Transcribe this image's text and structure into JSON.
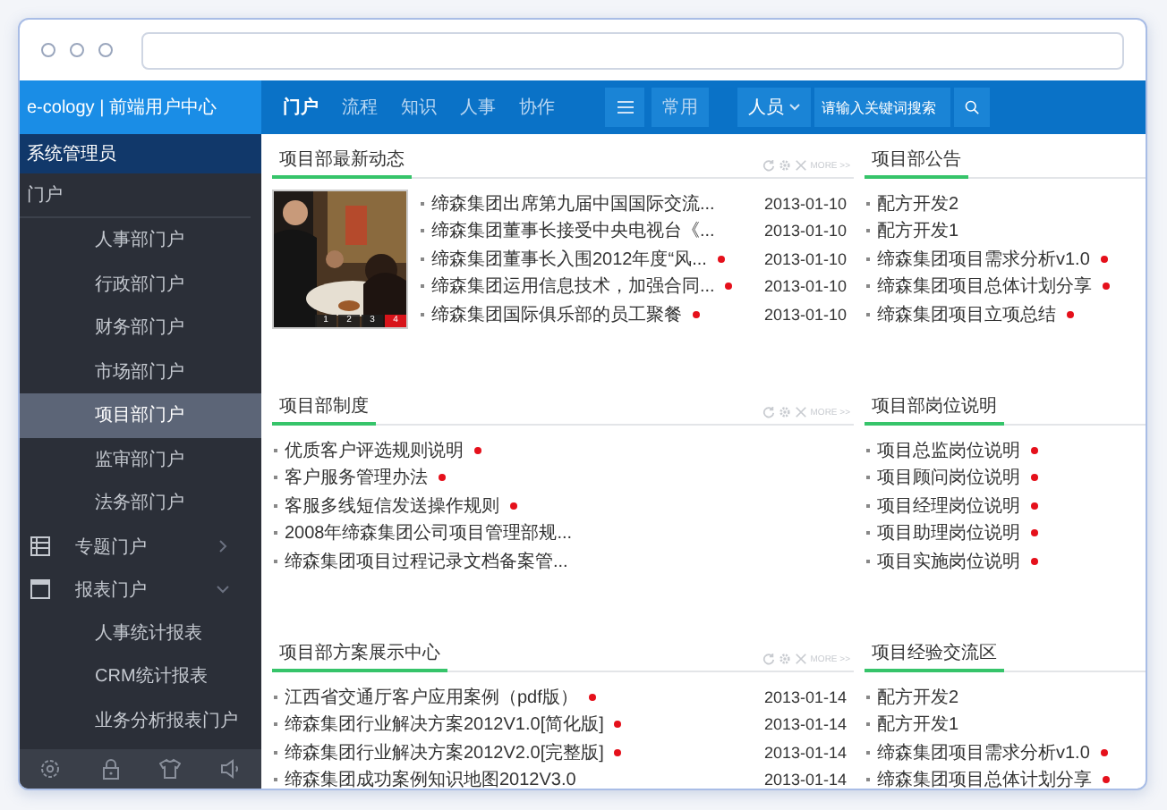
{
  "header": {
    "logo": "e-cology | 前端用户中心",
    "nav": [
      {
        "label": "门户",
        "selected": true
      },
      {
        "label": "流程",
        "selected": false
      },
      {
        "label": "知识",
        "selected": false
      },
      {
        "label": "人事",
        "selected": false
      },
      {
        "label": "协作",
        "selected": false
      }
    ],
    "common_button": "常用",
    "scope": "人员",
    "search": {
      "placeholder": "请输入关键词搜索"
    }
  },
  "sidebar": {
    "user": "系统管理员",
    "items": [
      {
        "label": "门户",
        "kind": "group",
        "children": [
          {
            "label": "人事部门户",
            "selected": false
          },
          {
            "label": "行政部门户",
            "selected": false
          },
          {
            "label": "财务部门户",
            "selected": false
          },
          {
            "label": "市场部门户",
            "selected": false
          },
          {
            "label": "项目部门户",
            "selected": true
          },
          {
            "label": "监审部门户",
            "selected": false
          },
          {
            "label": "法务部门户",
            "selected": false
          }
        ]
      },
      {
        "label": "专题门户",
        "kind": "table",
        "expanded": false
      },
      {
        "label": "报表门户",
        "kind": "window",
        "expanded": true,
        "children": [
          {
            "label": "人事统计报表",
            "selected": false
          },
          {
            "label": "CRM统计报表",
            "selected": false
          },
          {
            "label": "业务分析报表门户",
            "selected": false
          }
        ]
      }
    ]
  },
  "sections": [
    {
      "left": {
        "title": "项目部最新动态",
        "more": "MORE >>",
        "slideshow": {
          "pages": [
            {
              "label": "1",
              "selected": false
            },
            {
              "label": "2",
              "selected": false
            },
            {
              "label": "3",
              "selected": false
            },
            {
              "label": "4",
              "selected": true
            }
          ]
        },
        "items": [
          {
            "title": "缔森集团出席第九届中国国际交流...",
            "date": "2013-01-10",
            "new": false
          },
          {
            "title": "缔森集团董事长接受中央电视台《...",
            "date": "2013-01-10",
            "new": false
          },
          {
            "title": "缔森集团董事长入围2012年度“风...",
            "date": "2013-01-10",
            "new": true
          },
          {
            "title": "缔森集团运用信息技术，加强合同...",
            "date": "2013-01-10",
            "new": true
          },
          {
            "title": "缔森集团国际俱乐部的员工聚餐",
            "date": "2013-01-10",
            "new": true
          }
        ]
      },
      "right": {
        "title": "项目部公告",
        "items": [
          {
            "title": "配方开发2",
            "new": false
          },
          {
            "title": "配方开发1",
            "new": false
          },
          {
            "title": "缔森集团项目需求分析v1.0",
            "new": true
          },
          {
            "title": "缔森集团项目总体计划分享",
            "new": true
          },
          {
            "title": "缔森集团项目立项总结",
            "new": true
          }
        ]
      }
    },
    {
      "left": {
        "title": "项目部制度",
        "more": "MORE >>",
        "items": [
          {
            "title": "优质客户评选规则说明",
            "new": true
          },
          {
            "title": "客户服务管理办法",
            "new": true
          },
          {
            "title": "客服多线短信发送操作规则",
            "new": true
          },
          {
            "title": "2008年缔森集团公司项目管理部规...",
            "new": false
          },
          {
            "title": "缔森集团项目过程记录文档备案管...",
            "new": false
          }
        ]
      },
      "right": {
        "title": "项目部岗位说明",
        "items": [
          {
            "title": "项目总监岗位说明",
            "new": true
          },
          {
            "title": "项目顾问岗位说明",
            "new": true
          },
          {
            "title": "项目经理岗位说明",
            "new": true
          },
          {
            "title": "项目助理岗位说明",
            "new": true
          },
          {
            "title": "项目实施岗位说明",
            "new": true
          }
        ]
      }
    },
    {
      "left": {
        "title": "项目部方案展示中心",
        "more": "MORE >>",
        "items": [
          {
            "title": "江西省交通厅客户应用案例（pdf版）",
            "date": "2013-01-14",
            "new": true
          },
          {
            "title": "缔森集团行业解决方案2012V1.0[简化版]",
            "date": "2013-01-14",
            "new": true
          },
          {
            "title": "缔森集团行业解决方案2012V2.0[完整版]",
            "date": "2013-01-14",
            "new": true
          },
          {
            "title": "缔森集团成功案例知识地图2012V3.0",
            "date": "2013-01-14",
            "new": false
          }
        ]
      },
      "right": {
        "title": "项目经验交流区",
        "items": [
          {
            "title": "配方开发2",
            "new": false
          },
          {
            "title": "配方开发1",
            "new": false
          },
          {
            "title": "缔森集团项目需求分析v1.0",
            "new": true
          },
          {
            "title": "缔森集团项目总体计划分享",
            "new": true
          }
        ]
      }
    }
  ]
}
